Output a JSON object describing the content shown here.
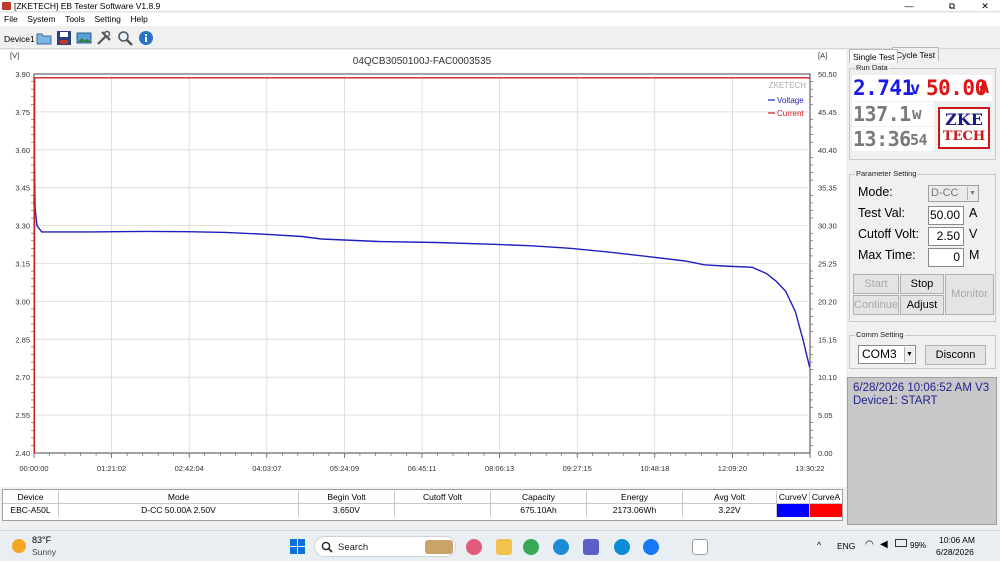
{
  "window": {
    "title": "[ZKETECH] EB Tester Software V1.8.9",
    "min": "—",
    "restore": "⧉",
    "close": "✕"
  },
  "menu": [
    "File",
    "System",
    "Tools",
    "Setting",
    "Help"
  ],
  "toolbar": {
    "device": "Device1"
  },
  "chart_data": {
    "type": "line",
    "title": "04QCB3050100J-FAC0003535",
    "watermark": "ZKETECH",
    "y_left_unit": "[V]",
    "y_right_unit": "[A]",
    "y_left_ticks": [
      "3.90",
      "3.75",
      "3.60",
      "3.45",
      "3.30",
      "3.15",
      "3.00",
      "2.85",
      "2.70",
      "2.55",
      "2.40"
    ],
    "y_right_ticks": [
      "50.50",
      "45.45",
      "40.40",
      "35.35",
      "30.30",
      "25.25",
      "20.20",
      "15.15",
      "10.10",
      "5.05",
      "0.00"
    ],
    "x_ticks": [
      "00:00:00",
      "01:21:02",
      "02:42:04",
      "04:03:07",
      "05:24:09",
      "06:45:11",
      "08:06:13",
      "09:27:15",
      "10:48:18",
      "12:09:20",
      "13:30:22"
    ],
    "ylim_left": [
      2.4,
      3.9
    ],
    "ylim_right": [
      0.0,
      50.5
    ],
    "xlim_minutes": [
      0,
      810.37
    ],
    "grid": true,
    "legend_position": "top-right",
    "series": [
      {
        "name": "Voltage",
        "axis": "left",
        "color": "#1f1fbf",
        "x": [
          0,
          0.5,
          1.2,
          3,
          8,
          20,
          60,
          120,
          160,
          200,
          240,
          280,
          300,
          360,
          420,
          480,
          520,
          560,
          600,
          640,
          680,
          700,
          720,
          750,
          765,
          775,
          785,
          795,
          803,
          810
        ],
        "y": [
          3.38,
          3.52,
          3.37,
          3.3,
          3.275,
          3.275,
          3.275,
          3.277,
          3.276,
          3.273,
          3.266,
          3.257,
          3.247,
          3.237,
          3.233,
          3.226,
          3.22,
          3.21,
          3.195,
          3.178,
          3.16,
          3.145,
          3.14,
          3.135,
          3.11,
          3.08,
          3.04,
          2.96,
          2.85,
          2.74
        ]
      },
      {
        "name": "Current",
        "axis": "right",
        "color": "#d01f1f",
        "x": [
          0,
          0.3,
          0.6,
          810
        ],
        "y": [
          0,
          0,
          50.0,
          50.0
        ]
      }
    ]
  },
  "tabs": [
    "Single Test",
    "Cycle Test"
  ],
  "run_data": {
    "group": "Run Data",
    "voltage": "2.741",
    "voltage_unit": "v",
    "current": "50.00",
    "current_unit": "A",
    "power": "137.1",
    "power_unit": "w",
    "time": "13:36",
    "seconds": "54",
    "logo_top": "ZKE",
    "logo_bottom": "TECH",
    "colors": {
      "voltage": "#1a1ae6",
      "current": "#e01515",
      "power": "#7a7a7a",
      "time": "#7a7a7a"
    }
  },
  "params": {
    "group": "Parameter Setting",
    "mode_label": "Mode:",
    "mode_value": "D-CC",
    "test_val_label": "Test Val:",
    "test_val": "50.00",
    "test_val_unit": "A",
    "cutoff_label": "Cutoff Volt:",
    "cutoff_val": "2.50",
    "cutoff_unit": "V",
    "maxtime_label": "Max Time:",
    "maxtime_val": "0",
    "maxtime_unit": "M",
    "start": "Start",
    "stop": "Stop",
    "continue": "Continue",
    "adjust": "Adjust",
    "monitor": "Monitor"
  },
  "comm": {
    "group": "Comm Setting",
    "port": "COM3",
    "disconn": "Disconn"
  },
  "status": {
    "line1": "6/28/2026 10:06:52 AM  V3",
    "line2": "Device1: START"
  },
  "table": {
    "headers": [
      "Device",
      "Mode",
      "Begin Volt",
      "Cutoff Volt",
      "Capacity",
      "Energy",
      "Avg Volt",
      "CurveV",
      "CurveA"
    ],
    "row": [
      "EBC-A50L",
      "D-CC  50.00A  2.50V",
      "3.650V",
      "",
      "675.10Ah",
      "2173.06Wh",
      "3.22V",
      "",
      ""
    ],
    "curve_colors": [
      "#0000ff",
      "#ff0000"
    ]
  },
  "taskbar": {
    "temp": "83°F",
    "weather": "Sunny",
    "search": "Search",
    "lang": "ENG",
    "battery": "99%",
    "time": "10:06 AM",
    "date": "6/28/2026"
  }
}
